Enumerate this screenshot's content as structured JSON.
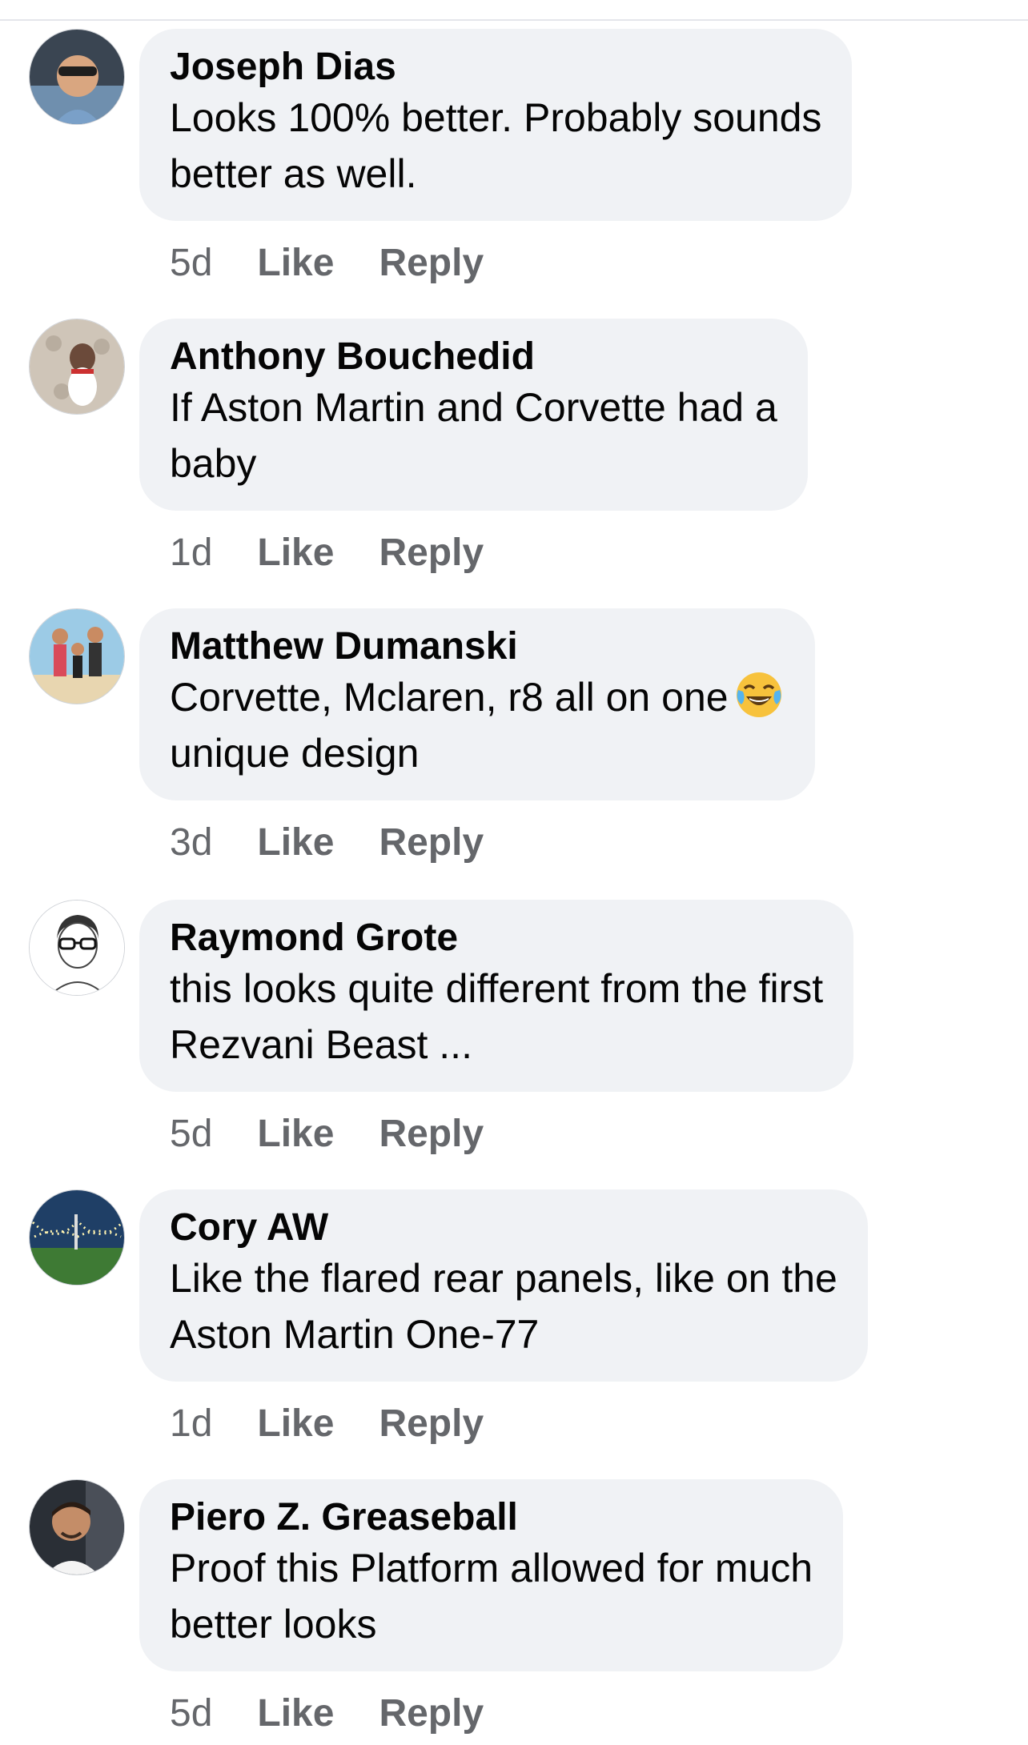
{
  "comments": [
    {
      "author": "Joseph Dias",
      "line1": "Looks 100% better. Probably sounds",
      "line2": "better as well.",
      "time": "5d",
      "like": "Like",
      "reply": "Reply"
    },
    {
      "author": "Anthony Bouchedid",
      "line1": "If Aston Martin and Corvette had a",
      "line2": "baby",
      "time": "1d",
      "like": "Like",
      "reply": "Reply"
    },
    {
      "author": "Matthew Dumanski",
      "line1": "Corvette, Mclaren, r8 all on one",
      "line2": "unique design",
      "emoji": "face-with-tears-of-joy-emoji",
      "time": "3d",
      "like": "Like",
      "reply": "Reply"
    },
    {
      "author": "Raymond Grote",
      "line1": "this looks quite different from the first",
      "line2": "Rezvani Beast ...",
      "time": "5d",
      "like": "Like",
      "reply": "Reply"
    },
    {
      "author": "Cory AW",
      "line1": "Like the flared rear panels, like on the",
      "line2": "Aston Martin One-77",
      "time": "1d",
      "like": "Like",
      "reply": "Reply"
    },
    {
      "author": "Piero Z. Greaseball",
      "line1": "Proof this Platform allowed for much",
      "line2": "better looks",
      "time": "5d",
      "like": "Like",
      "reply": "Reply"
    }
  ],
  "colors": {
    "bubble": "#f0f2f5",
    "text": "#050505",
    "meta": "#65676b"
  }
}
